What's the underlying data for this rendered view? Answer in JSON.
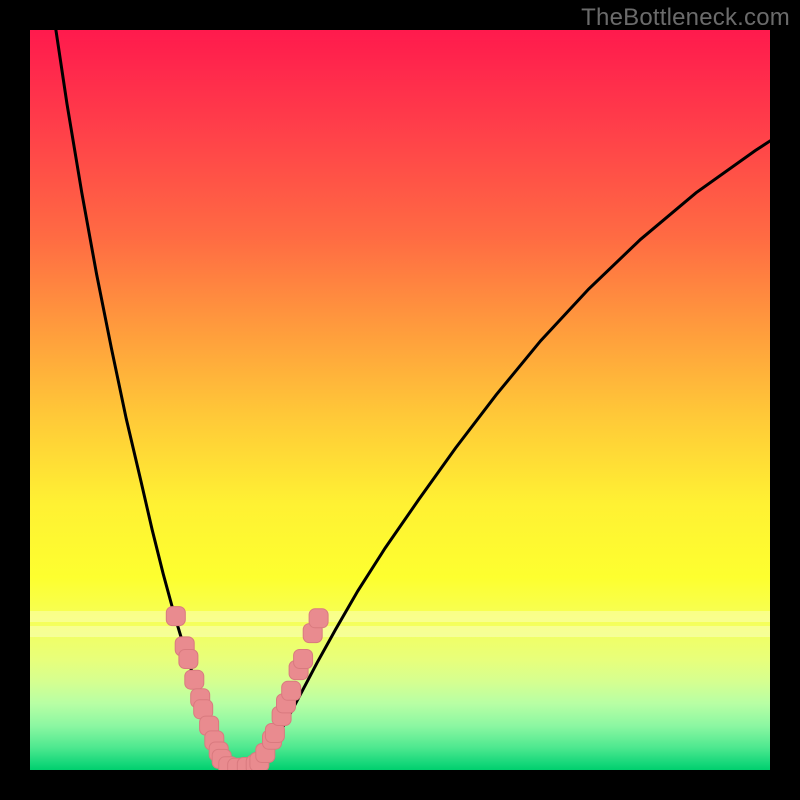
{
  "watermark": "TheBottleneck.com",
  "colors": {
    "frame": "#000000",
    "curve": "#000000",
    "marker_fill": "#e98b8f",
    "marker_stroke": "#d97a7f",
    "gradient_top": "#ff1a4d",
    "gradient_bottom": "#00cf6e"
  },
  "chart_data": {
    "type": "line",
    "title": "",
    "xlabel": "",
    "ylabel": "",
    "xlim": [
      0,
      100
    ],
    "ylim": [
      0,
      100
    ],
    "legend": false,
    "grid": false,
    "note": "Axes are percentage scales (0–100). Values estimated from pixel positions; y is inverted so 0 is at the top of the plot, 100 at the bottom (green).",
    "pale_bands_y": [
      {
        "from": 78.5,
        "to": 80.0
      },
      {
        "from": 80.5,
        "to": 82.0
      }
    ],
    "series": [
      {
        "name": "left-curve",
        "x": [
          3.5,
          5.0,
          7.0,
          9.0,
          11.0,
          13.0,
          15.0,
          16.5,
          18.0,
          19.5,
          21.0,
          22.3,
          23.4,
          24.3,
          25.0,
          25.6,
          26.0,
          26.2
        ],
        "y": [
          0.0,
          10.0,
          22.0,
          33.0,
          43.0,
          52.5,
          61.0,
          67.5,
          73.5,
          79.0,
          84.0,
          88.0,
          91.5,
          94.2,
          96.3,
          97.8,
          98.7,
          99.2
        ]
      },
      {
        "name": "trough",
        "x": [
          26.2,
          26.6,
          27.1,
          27.7,
          28.4,
          29.1,
          29.8,
          30.4,
          31.0
        ],
        "y": [
          99.2,
          99.5,
          99.7,
          99.8,
          99.85,
          99.8,
          99.7,
          99.5,
          99.2
        ]
      },
      {
        "name": "right-curve",
        "x": [
          31.0,
          31.7,
          32.6,
          33.7,
          35.1,
          36.8,
          38.8,
          41.3,
          44.3,
          48.0,
          52.5,
          57.5,
          63.0,
          69.0,
          75.5,
          82.5,
          90.0,
          98.0,
          100.0
        ],
        "y": [
          99.2,
          98.3,
          96.9,
          95.0,
          92.5,
          89.3,
          85.5,
          81.0,
          75.8,
          70.0,
          63.5,
          56.5,
          49.3,
          42.0,
          35.0,
          28.3,
          22.0,
          16.3,
          15.0
        ]
      }
    ],
    "markers": {
      "name": "highlighted-points",
      "shape": "rounded-rect",
      "approx_size_px": 20,
      "points": [
        {
          "x": 19.7,
          "y": 79.2
        },
        {
          "x": 20.9,
          "y": 83.3
        },
        {
          "x": 21.4,
          "y": 85.0
        },
        {
          "x": 22.2,
          "y": 87.8
        },
        {
          "x": 23.0,
          "y": 90.3
        },
        {
          "x": 23.4,
          "y": 91.8
        },
        {
          "x": 24.2,
          "y": 94.0
        },
        {
          "x": 24.9,
          "y": 96.0
        },
        {
          "x": 25.5,
          "y": 97.5
        },
        {
          "x": 25.9,
          "y": 98.5
        },
        {
          "x": 26.8,
          "y": 99.5
        },
        {
          "x": 28.0,
          "y": 99.7
        },
        {
          "x": 29.3,
          "y": 99.6
        },
        {
          "x": 30.5,
          "y": 99.3
        },
        {
          "x": 31.0,
          "y": 98.9
        },
        {
          "x": 31.8,
          "y": 97.7
        },
        {
          "x": 32.7,
          "y": 95.9
        },
        {
          "x": 33.1,
          "y": 95.0
        },
        {
          "x": 34.0,
          "y": 92.7
        },
        {
          "x": 34.6,
          "y": 91.0
        },
        {
          "x": 35.3,
          "y": 89.3
        },
        {
          "x": 36.3,
          "y": 86.5
        },
        {
          "x": 36.9,
          "y": 85.0
        },
        {
          "x": 38.2,
          "y": 81.5
        },
        {
          "x": 39.0,
          "y": 79.5
        }
      ]
    }
  }
}
